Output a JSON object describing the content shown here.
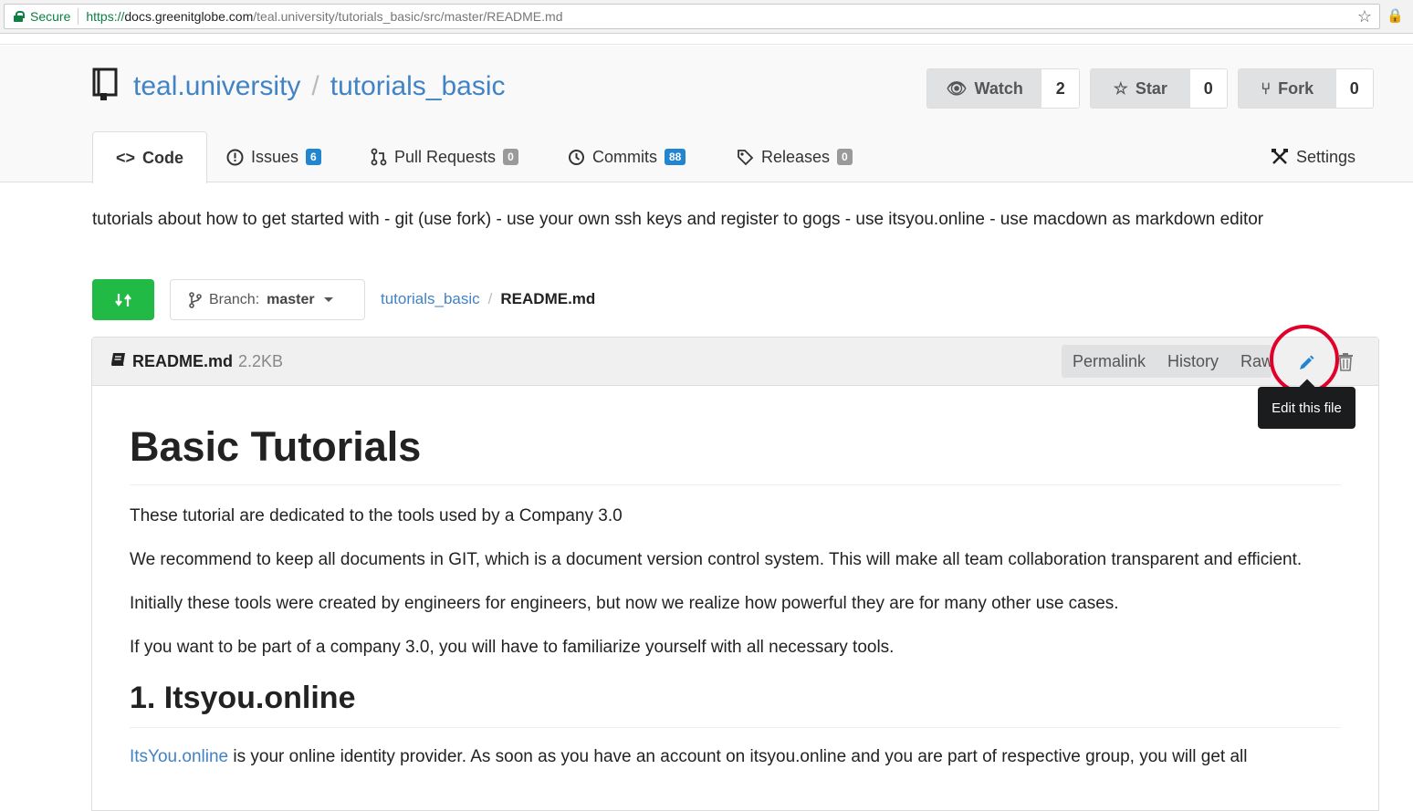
{
  "browser": {
    "secure_label": "Secure",
    "url_scheme": "https://",
    "url_host": "docs.greenitglobe.com",
    "url_path": "/teal.university/tutorials_basic/src/master/README.md"
  },
  "repo": {
    "owner": "teal.university",
    "separator": "/",
    "name": "tutorials_basic",
    "watch_label": "Watch",
    "watch_count": "2",
    "star_label": "Star",
    "star_count": "0",
    "fork_label": "Fork",
    "fork_count": "0"
  },
  "tabs": [
    {
      "label": "Code",
      "icon": "code-icon"
    },
    {
      "label": "Issues",
      "badge": "6",
      "icon": "issue-icon"
    },
    {
      "label": "Pull Requests",
      "badge": "0",
      "icon": "pull-request-icon"
    },
    {
      "label": "Commits",
      "badge": "88",
      "icon": "commit-icon"
    },
    {
      "label": "Releases",
      "badge": "0",
      "icon": "tag-icon"
    },
    {
      "label": "Settings",
      "icon": "tools-icon"
    }
  ],
  "description": "tutorials about how to get started with - git (use fork) - use your own ssh keys and register to gogs - use itsyou.online - use macdown as markdown editor",
  "branch": {
    "label": "Branch:",
    "name": "master"
  },
  "path": {
    "repo": "tutorials_basic",
    "separator": "/",
    "file": "README.md"
  },
  "file": {
    "name": "README.md",
    "size": "2.2KB",
    "actions": [
      "Permalink",
      "History",
      "Raw"
    ],
    "tooltip": "Edit this file"
  },
  "markdown": {
    "h1": "Basic Tutorials",
    "p1": "These tutorial are dedicated to the tools used by a Company 3.0",
    "p2": "We recommend to keep all documents in GIT, which is a document version control system. This will make all team collaboration transparent and efficient.",
    "p3": "Initially these tools were created by engineers for engineers, but now we realize how powerful they are for many other use cases.",
    "p4": "If you want to be part of a company 3.0, you will have to familiarize yourself with all necessary tools.",
    "h2": "1. Itsyou.online",
    "p5_link": "ItsYou.online",
    "p5_text": " is your online identity provider. As soon as you have an account on itsyou.online and you are part of respective group, you will get all"
  },
  "colors": {
    "link": "#4183c4",
    "green_button": "#21ba45",
    "badge_blue": "#2185d0",
    "highlight_ring": "#e0002a"
  }
}
